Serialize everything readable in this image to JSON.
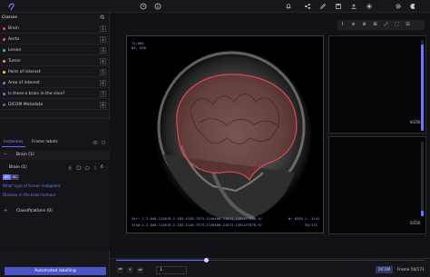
{
  "top_icons": [
    "clock-icon",
    "info-icon",
    "bell-icon",
    "share-icon",
    "pencil-icon",
    "save-icon",
    "upload-icon",
    "sun-icon",
    "gear-icon",
    "moon-icon"
  ],
  "classes": {
    "title": "Classes",
    "items": [
      {
        "label": "Brain",
        "key": "1",
        "color": "#e0485a"
      },
      {
        "label": "Aorta",
        "key": "2",
        "color": "#e35c8a"
      },
      {
        "label": "Lesion",
        "key": "3",
        "color": "#3fc1d8"
      },
      {
        "label": "Tumor",
        "key": "4",
        "color": "#f1a43b"
      },
      {
        "label": "Point of interest",
        "key": "5",
        "color": "#e8d76a"
      },
      {
        "label": "Area of interest",
        "key": "6",
        "color": "#7b7ff0"
      },
      {
        "label": "Is there a brain in the slice?",
        "key": "7",
        "color": "#9a68d9"
      },
      {
        "label": "DICOM Metadata",
        "key": "8",
        "color": "#6e6e78"
      }
    ]
  },
  "tabs": {
    "instances": "Instances",
    "frame_labels": "Frame labels"
  },
  "instances": {
    "class_label": "Brain (1)",
    "instance_label": "Brain (1)",
    "instance_num": "6",
    "pills": [
      {
        "text": "4S",
        "color": "#6f7cff"
      },
      {
        "text": "SC",
        "color": "#3a3f66"
      }
    ],
    "questions": [
      "What type of tumor malignant",
      "Disease in the brain tumour"
    ],
    "classifications": "Classifications (0)"
  },
  "auto_labelling": "Automated labelling",
  "viewer": {
    "overlay_top": [
      "Ti:065",
      "WI: 036"
    ],
    "overlay_bottom_left": [
      "Ser: 1.2.840.113619.2.283.4120.7575.2146400.21673.1391477878.9/",
      "Stud:1.2.840.113619.2.283.4120.7575.2146400.21673.1391477878.9/"
    ],
    "overlay_bottom_right": [
      "W: 6283 L: 3141",
      "50/171"
    ],
    "side_counts": [
      "0/256",
      "0/256"
    ],
    "side_slider_levels": [
      0.95,
      0.4
    ],
    "tools": [
      "I",
      "≡",
      "⊕",
      "⊞",
      "⤢",
      "⛶",
      "⊟"
    ]
  },
  "timeline": {
    "progress": 0.29,
    "controls": [
      "⏮",
      "⏸",
      "⏭"
    ],
    "speed": "1",
    "dicom_btn": "DICOM",
    "frame_text": "Frame 50/171"
  }
}
